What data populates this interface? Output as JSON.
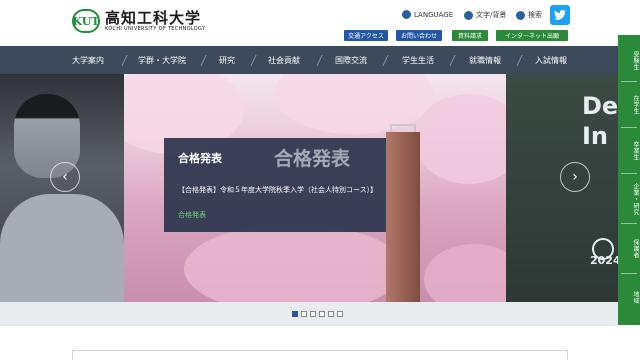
{
  "header": {
    "logo_mark": "KUT",
    "logo_jp": "高知工科大学",
    "logo_en": "KOCHI UNIVERSITY OF TECHNOLOGY",
    "language": "LANGUAGE",
    "text_size": "文字/背景",
    "search": "検索"
  },
  "quick_links": [
    "交通アクセス",
    "お問い合わせ",
    "資料請求",
    "インターネット出願"
  ],
  "nav": [
    "大学案内",
    "学群・大学院",
    "研究",
    "社会貢献",
    "国際交流",
    "学生生活",
    "就職情報",
    "入試情報"
  ],
  "hero": {
    "right_line1": "De",
    "right_line2": "In",
    "right_year": "2024"
  },
  "news": {
    "title": "合格発表",
    "big": "合格発表",
    "text": "【合格発表】令和５年度大学院秋季入学（社会人特別コース）】",
    "tag": "合格発表"
  },
  "side_tabs": [
    "受験生",
    "在学生",
    "卒業生",
    "企業・研究",
    "保護者",
    "地域"
  ],
  "colors": {
    "nav": "#3d4a5c",
    "green": "#2a8a3a",
    "blue": "#2456a8",
    "news": "#2b344d"
  }
}
